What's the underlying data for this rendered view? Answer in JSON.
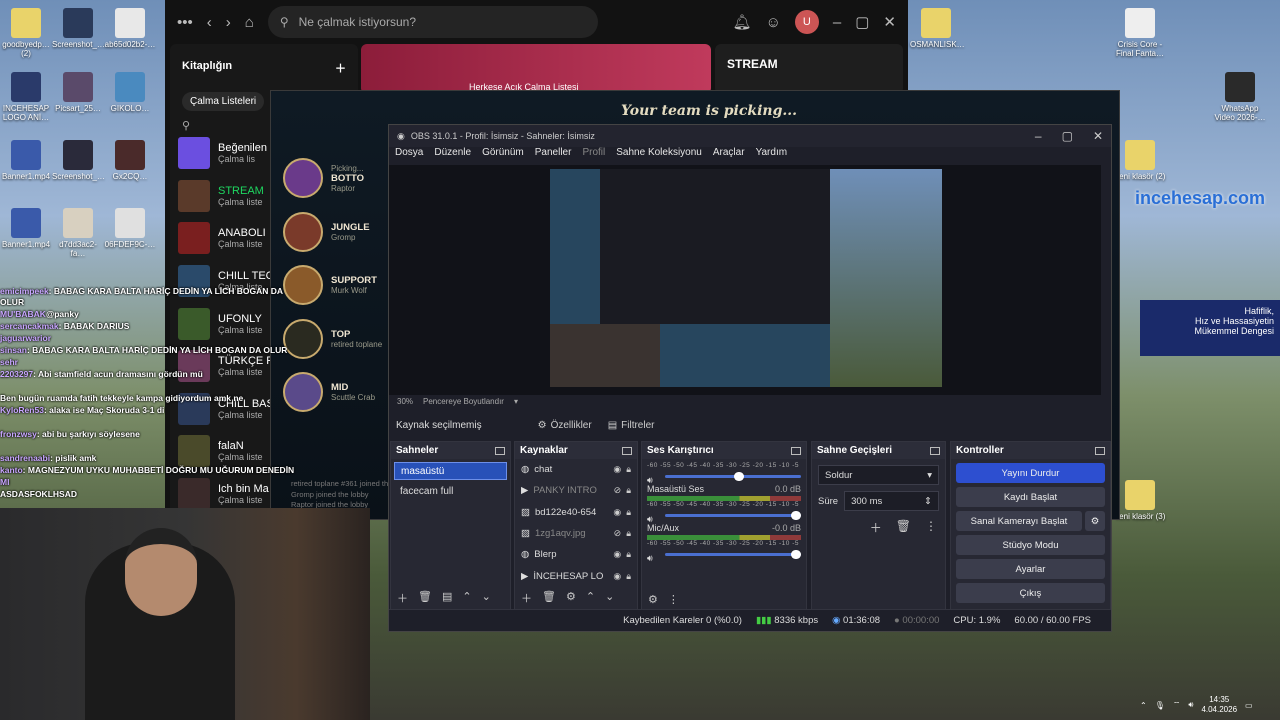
{
  "desktop": {
    "left_icons": [
      "goodbyedp…(2)",
      "Screenshot_…",
      "ab65d02b2-…",
      "INCEHESAP LOGO ANİ…",
      "Picsart_25…",
      "GIKOLO…",
      "Banner1.mp4",
      "Screenshot_…",
      "Gx2CQ…",
      "Banner1.mp4",
      "d7dd3ac2-fa…",
      "06FDEF9C-…"
    ],
    "right_icons": [
      "OSMANLISK…",
      "Crisis Core - Final Fanta…",
      "WhatsApp Video 2026-…",
      "Yeni klasör (2)",
      "Yeni klasör (3)"
    ],
    "watermark": "incehesap.com",
    "promo": {
      "line1": "Hafiflik,",
      "line2": "Hız ve Hassasiyetin",
      "line3": "Mükemmel Dengesi"
    }
  },
  "spotify": {
    "search_placeholder": "Ne çalmak istiyorsun?",
    "library_title": "Kitaplığın",
    "filter_chip": "Çalma Listeleri",
    "card_label": "Herkese Açık Çalma Listesi",
    "card2_label": "STREAM",
    "avatar_letter": "U",
    "playlists": [
      {
        "title": "Beğenilen",
        "sub": "Çalma lis",
        "color": "#6b4fe0"
      },
      {
        "title": "STREAM",
        "sub": "Çalma liste",
        "color": "#5a3a2a",
        "active": true
      },
      {
        "title": "ANABOLI",
        "sub": "Çalma liste",
        "color": "#7a1f1f"
      },
      {
        "title": "CHILL TEC",
        "sub": "Çalma liste",
        "color": "#2a4a6a"
      },
      {
        "title": "UFONLY",
        "sub": "Çalma liste",
        "color": "#3a5a2a"
      },
      {
        "title": "TÜRKÇE R",
        "sub": "Çalma liste",
        "color": "#6a3a5a"
      },
      {
        "title": "CHILL BAS",
        "sub": "Çalma liste",
        "color": "#2a3a5a"
      },
      {
        "title": "falaN",
        "sub": "Çalma liste",
        "color": "#4a4a2a"
      },
      {
        "title": "Ich bin Ma",
        "sub": "Çalma liste",
        "color": "#3a2a2a"
      }
    ]
  },
  "chat": [
    {
      "user": "emicimpeek",
      "msg": ": BABAG KARA BALTA HARİÇ DEDİN YA LİCH BOGAN DA OLUR"
    },
    {
      "user": "MU'BABAK",
      "msg": "@panky"
    },
    {
      "user": "sercancakmak",
      "msg": ": BABAK DARIUS"
    },
    {
      "user": "jaguarwarior",
      "msg": ""
    },
    {
      "user": "sinsan",
      "msg": ": BABAG KARA BALTA HARİÇ DEDİN YA LİCH BOGAN DA OLUR"
    },
    {
      "user": "sehr",
      "msg": ""
    },
    {
      "user": "2203297",
      "msg": ": Abi stamfield acun dramasını gördün mü"
    },
    {
      "user": "",
      "msg": ""
    },
    {
      "user": "",
      "msg": "Ben bugün ruamda fatih tekkeyle kampa gidiyordum amk ne"
    },
    {
      "user": "KyloRen53",
      "msg": ": alaka ise Maç Skoruda 3-1 di"
    },
    {
      "user": "",
      "msg": ""
    },
    {
      "user": "fronzwsy",
      "msg": ": abi bu şarkıyı söylesene"
    },
    {
      "user": "",
      "msg": ""
    },
    {
      "user": "sandrenaabi",
      "msg": ": pislik amk"
    },
    {
      "user": "kanto",
      "msg": ": MAGNEZYUM UYKU MUHABBETİ DOĞRU MU UĞURUM DENEDİN"
    },
    {
      "user": "MI",
      "msg": ""
    },
    {
      "user": "",
      "msg": "ASDASFOKLHSAD"
    }
  ],
  "game": {
    "title": "Your team is picking...",
    "roles": [
      {
        "label": "Picking...",
        "name": "BOTTO",
        "player": "Raptor",
        "color": "#6a3a8a"
      },
      {
        "label": "",
        "name": "JUNGLE",
        "player": "Gromp",
        "color": "#7a3a2a"
      },
      {
        "label": "",
        "name": "SUPPORT",
        "player": "Murk Wolf",
        "color": "#8a5a2a"
      },
      {
        "label": "",
        "name": "TOP",
        "player": "retired toplane",
        "color": "#2a2a20"
      },
      {
        "label": "",
        "name": "MID",
        "player": "Scuttle Crab",
        "color": "#5a4a8a"
      }
    ],
    "log": [
      "retired toplane #361 joined the lobby",
      "Gromp joined the lobby",
      "Raptor joined the lobby"
    ]
  },
  "obs": {
    "title": "OBS 31.0.1 - Profil: İsimsiz - Sahneler: İsimsiz",
    "menu": [
      "Dosya",
      "Düzenle",
      "Görünüm",
      "Paneller",
      "Profil",
      "Sahne Koleksiyonu",
      "Araçlar",
      "Yardım"
    ],
    "zoom": "30%",
    "zoom_mode": "Pencereye Boyutlandır",
    "source_selected": "Kaynak seçilmemiş",
    "props_label": "Özellikler",
    "filters_label": "Filtreler",
    "scenes_title": "Sahneler",
    "scenes": [
      "masaüstü",
      "facecam full"
    ],
    "sources_title": "Kaynaklar",
    "sources": [
      {
        "name": "chat",
        "icon": "globe-icon",
        "dim": false
      },
      {
        "name": "PANKY INTRO",
        "icon": "play-icon",
        "dim": true
      },
      {
        "name": "bd122e40-654",
        "icon": "image-icon",
        "dim": false
      },
      {
        "name": "1zg1aqv.jpg",
        "icon": "image-icon",
        "dim": true
      },
      {
        "name": "Blerp",
        "icon": "globe-icon",
        "dim": false
      },
      {
        "name": "İNCEHESAP LO",
        "icon": "play-icon",
        "dim": false
      }
    ],
    "mixer_title": "Ses Karıştırıcı",
    "mixer_ticks": "-60 -55 -50 -45 -40 -35 -30 -25 -20 -15 -10 -5 0",
    "mixer": [
      {
        "name": "",
        "db": "",
        "level": 0.58
      },
      {
        "name": "Masaüstü Ses",
        "db": "0.0 dB",
        "level": 1.0
      },
      {
        "name": "Mic/Aux",
        "db": "-0.0 dB",
        "level": 1.0
      }
    ],
    "transitions_title": "Sahne Geçişleri",
    "transition": "Soldur",
    "duration_label": "Süre",
    "duration": "300 ms",
    "controls_title": "Kontroller",
    "controls": [
      "Yayını Durdur",
      "Kaydı Başlat",
      "Sanal Kamerayı Başlat",
      "Stüdyo Modu",
      "Ayarlar",
      "Çıkış"
    ],
    "status": {
      "dropped": "Kaybedilen Kareler 0 (%0.0)",
      "bitrate": "8336 kbps",
      "stream_time": "01:36:08",
      "rec_time": "00:00:00",
      "cpu": "CPU: 1.9%",
      "fps": "60.00 / 60.00 FPS"
    }
  },
  "taskbar": {
    "time": "14:35",
    "date": "4.04.2026"
  }
}
